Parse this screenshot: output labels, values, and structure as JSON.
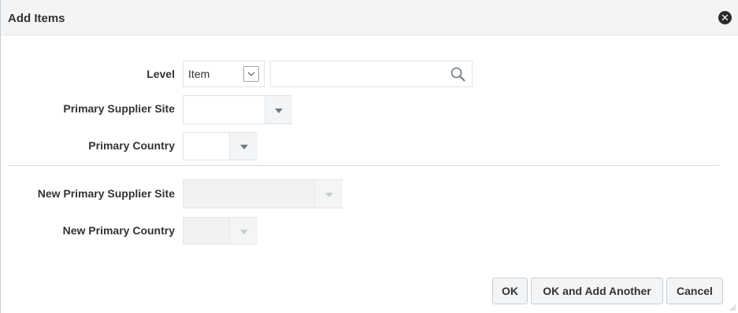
{
  "dialog": {
    "title": "Add Items",
    "close_icon": "close-circle-icon"
  },
  "form": {
    "level": {
      "label": "Level",
      "value": "Item",
      "search_value": "",
      "search_icon": "magnifier-icon"
    },
    "primary_supplier_site": {
      "label": "Primary Supplier Site",
      "value": ""
    },
    "primary_country": {
      "label": "Primary Country",
      "value": ""
    },
    "new_primary_supplier_site": {
      "label": "New Primary Supplier Site",
      "value": "",
      "disabled": true
    },
    "new_primary_country": {
      "label": "New Primary Country",
      "value": "",
      "disabled": true
    }
  },
  "footer": {
    "ok_label": "OK",
    "ok_add_another_label": "OK and Add Another",
    "cancel_label": "Cancel"
  }
}
